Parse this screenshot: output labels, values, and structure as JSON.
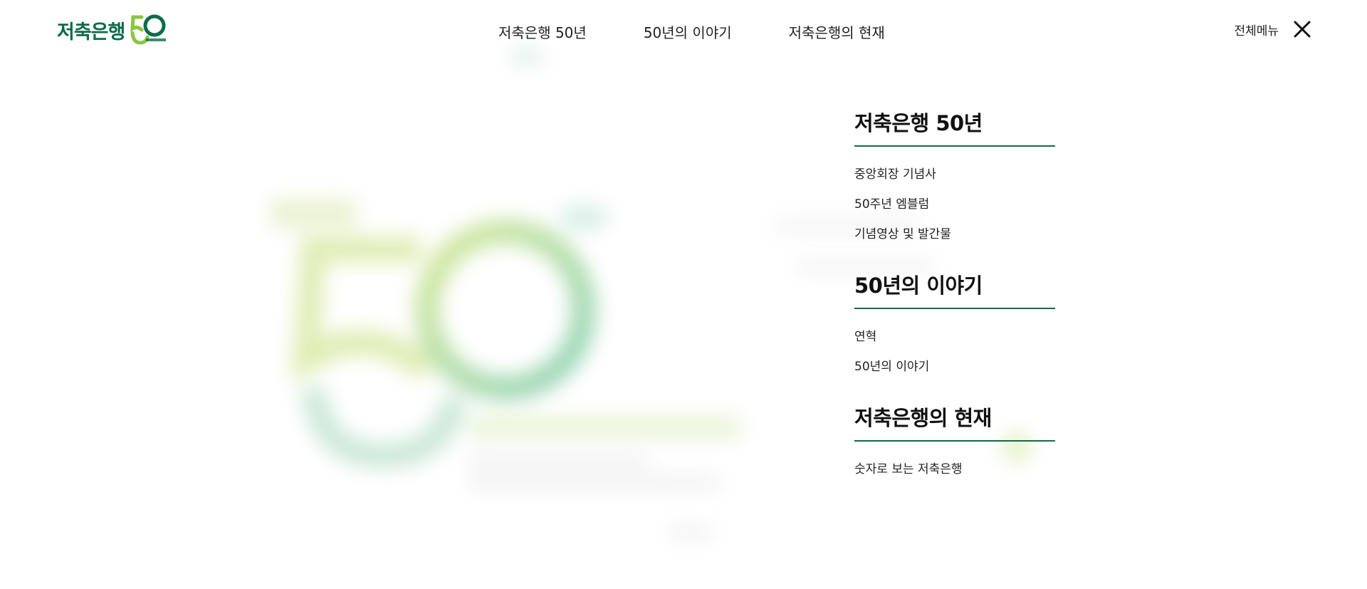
{
  "logo": {
    "text": "저축은행",
    "mark_icon": "50th-anniversary-logo-mark"
  },
  "nav": {
    "items": [
      {
        "label": "저축은행 50년"
      },
      {
        "label": "50년의 이야기"
      },
      {
        "label": "저축은행의 현재"
      }
    ]
  },
  "allmenu": {
    "label": "전체메뉴",
    "close_icon": "close-icon"
  },
  "sitemap": {
    "groups": [
      {
        "title": "저축은행 50년",
        "links": [
          "중앙회장 기념사",
          "50주년 엠블럼",
          "기념영상 및 발간물"
        ]
      },
      {
        "title": "50년의 이야기",
        "links": [
          "연혁",
          "50년의 이야기"
        ]
      },
      {
        "title": "저축은행의 현재",
        "links": [
          "숫자로 보는 저축은행"
        ]
      }
    ]
  },
  "colors": {
    "brand_green": "#0d6b4a",
    "accent_light_green": "#8cc63f",
    "text": "#222222"
  }
}
